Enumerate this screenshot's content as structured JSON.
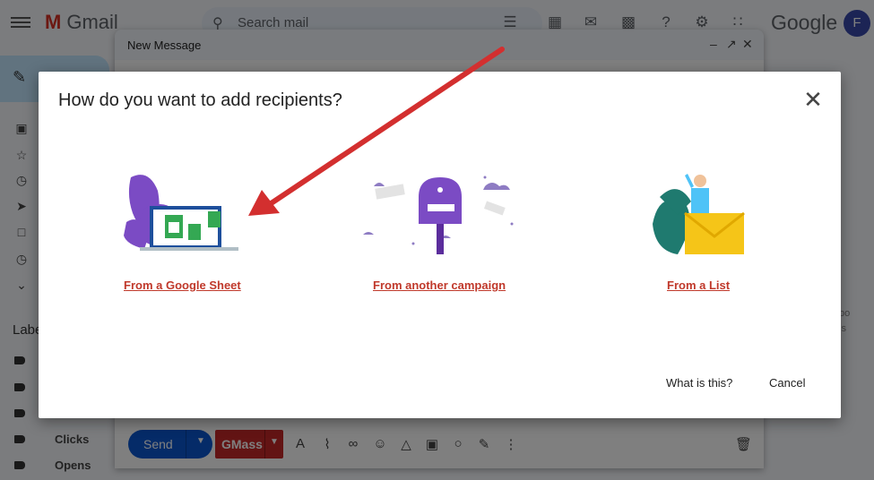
{
  "gmail": {
    "app_name": "Gmail",
    "search_placeholder": "Search mail",
    "google_word": "Google",
    "avatar_initial": "F",
    "labels_heading": "Labe",
    "labels": [
      "Clicks",
      "Opens"
    ],
    "right_fragments": [
      "bo",
      "ls"
    ]
  },
  "compose": {
    "title": "New Message",
    "send_label": "Send",
    "gmass_label": "GMass"
  },
  "dialog": {
    "title": "How do you want to add recipients?",
    "options": [
      {
        "label": "From a Google Sheet"
      },
      {
        "label": "From another campaign"
      },
      {
        "label": "From a List"
      }
    ],
    "help_label": "What is this?",
    "cancel_label": "Cancel"
  },
  "colors": {
    "link": "#c0392b",
    "arrow": "#d32f2f",
    "send_blue": "#0b57d0",
    "gmass_red": "#c62828",
    "illustration_purple": "#7b4bc4",
    "envelope_yellow": "#f5c518"
  },
  "icons": [
    "menu-icon",
    "gmail-logo-icon",
    "search-icon",
    "filter-icon",
    "sheet-icon",
    "gmass-icon",
    "keyboard-icon",
    "help-icon",
    "gear-icon",
    "apps-icon",
    "pencil-icon",
    "inbox-icon",
    "star-icon",
    "clock-icon",
    "send-icon",
    "draft-icon",
    "snooze-icon",
    "chevron-down-icon",
    "close-icon",
    "minimize-icon",
    "expand-icon",
    "dropdown-icon",
    "format-text-icon",
    "attach-icon",
    "link-icon",
    "emoji-icon",
    "drive-icon",
    "image-icon",
    "lock-icon",
    "signature-icon",
    "more-icon",
    "trash-icon",
    "label-icon"
  ]
}
